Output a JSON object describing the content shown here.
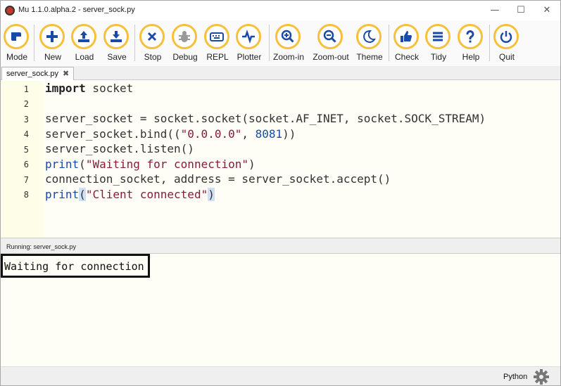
{
  "window": {
    "title": "Mu 1.1.0.alpha.2 - server_sock.py",
    "minimize": "—",
    "maximize": "☐",
    "close": "✕"
  },
  "toolbar": {
    "buttons": [
      {
        "label": "Mode",
        "icon": "mode-icon"
      },
      {
        "label": "New",
        "icon": "plus-icon"
      },
      {
        "label": "Load",
        "icon": "upload-icon"
      },
      {
        "label": "Save",
        "icon": "download-icon"
      },
      {
        "label": "Stop",
        "icon": "close-icon"
      },
      {
        "label": "Debug",
        "icon": "bug-icon"
      },
      {
        "label": "REPL",
        "icon": "keyboard-icon"
      },
      {
        "label": "Plotter",
        "icon": "pulse-icon"
      },
      {
        "label": "Zoom-in",
        "icon": "zoom-in-icon"
      },
      {
        "label": "Zoom-out",
        "icon": "zoom-out-icon"
      },
      {
        "label": "Theme",
        "icon": "moon-icon"
      },
      {
        "label": "Check",
        "icon": "thumbs-up-icon"
      },
      {
        "label": "Tidy",
        "icon": "menu-icon"
      },
      {
        "label": "Help",
        "icon": "question-icon"
      },
      {
        "label": "Quit",
        "icon": "power-icon"
      }
    ],
    "accent_color": "#f8bf3b",
    "icon_color": "#1a4aa8"
  },
  "tabs": [
    {
      "label": "server_sock.py",
      "close": "✖"
    }
  ],
  "editor": {
    "line_numbers": [
      "1",
      "2",
      "3",
      "4",
      "5",
      "6",
      "7",
      "8"
    ],
    "lines": [
      "import socket",
      "",
      "server_socket = socket.socket(socket.AF_INET, socket.SOCK_STREAM)",
      "server_socket.bind((\"0.0.0.0\", 8081))",
      "server_socket.listen()",
      "print(\"Waiting for connection\")",
      "connection_socket, address = server_socket.accept()",
      "print(\"Client connected\")"
    ]
  },
  "run_pane": {
    "header": "Running: server_sock.py",
    "output": "Waiting for connection"
  },
  "status": {
    "mode": "Python",
    "settings_icon": "gear-icon"
  }
}
